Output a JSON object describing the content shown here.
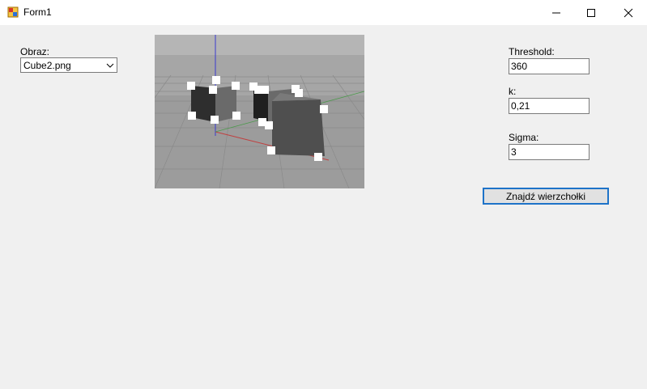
{
  "window": {
    "title": "Form1"
  },
  "image_panel": {
    "label": "Obraz:",
    "selected": "Cube2.png"
  },
  "params": {
    "threshold_label": "Threshold:",
    "threshold_value": "360",
    "k_label": "k:",
    "k_value": "0,21",
    "sigma_label": "Sigma:",
    "sigma_value": "3"
  },
  "actions": {
    "find_corners_label": "Znajdź wierzchołki"
  },
  "icons": {
    "app": "app-form-icon",
    "minimize": "minimize-icon",
    "maximize": "maximize-icon",
    "close": "close-icon",
    "dropdown": "chevron-down-icon"
  }
}
